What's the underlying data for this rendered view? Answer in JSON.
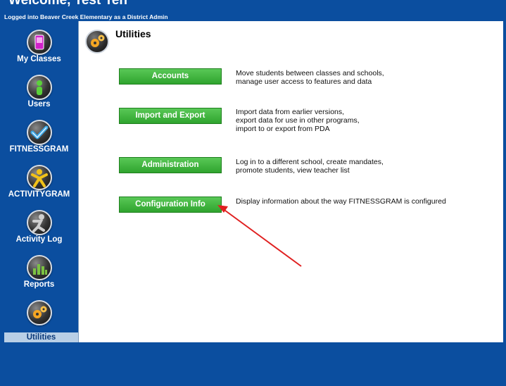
{
  "header": {
    "welcome": "Welcome, Test Teh",
    "status": "Logged into Beaver Creek Elementary as a District Admin"
  },
  "sidebar": {
    "items": [
      {
        "label": "My Classes",
        "icon": "phone-icon",
        "color": "#d020c9"
      },
      {
        "label": "Users",
        "icon": "person-icon",
        "color": "#5bd13a"
      },
      {
        "label": "FITNESSGRAM",
        "icon": "checkmark-icon",
        "color": "#3ba8e8"
      },
      {
        "label": "ACTIVITYGRAM",
        "icon": "runner-icon",
        "color": "#f2c218"
      },
      {
        "label": "Activity Log",
        "icon": "runner-gray-icon",
        "color": "#bdbdbd"
      },
      {
        "label": "Reports",
        "icon": "bar-chart-icon",
        "color": "#7bc242"
      },
      {
        "label": "Utilities",
        "icon": "gears-icon",
        "color": "#f5a623",
        "active": true
      }
    ]
  },
  "main": {
    "title": "Utilities",
    "title_icon": "gears-icon",
    "actions": [
      {
        "button": "Accounts",
        "desc": [
          "Move students between classes and schools,",
          "manage user access to features and data"
        ]
      },
      {
        "button": "Import and Export",
        "desc": [
          "Import data from earlier versions,",
          "export data for use in other programs,",
          "import to or export from PDA"
        ]
      },
      {
        "button": "Administration",
        "desc": [
          "Log in to a different school, create mandates,",
          "promote students, view teacher list"
        ]
      },
      {
        "button": "Configuration Info",
        "desc": [
          "Display information about the way FITNESSGRAM is configured"
        ]
      }
    ]
  },
  "colors": {
    "background": "#0b4e9f",
    "button": "#3cb43a",
    "annotation_arrow": "#e02020"
  }
}
